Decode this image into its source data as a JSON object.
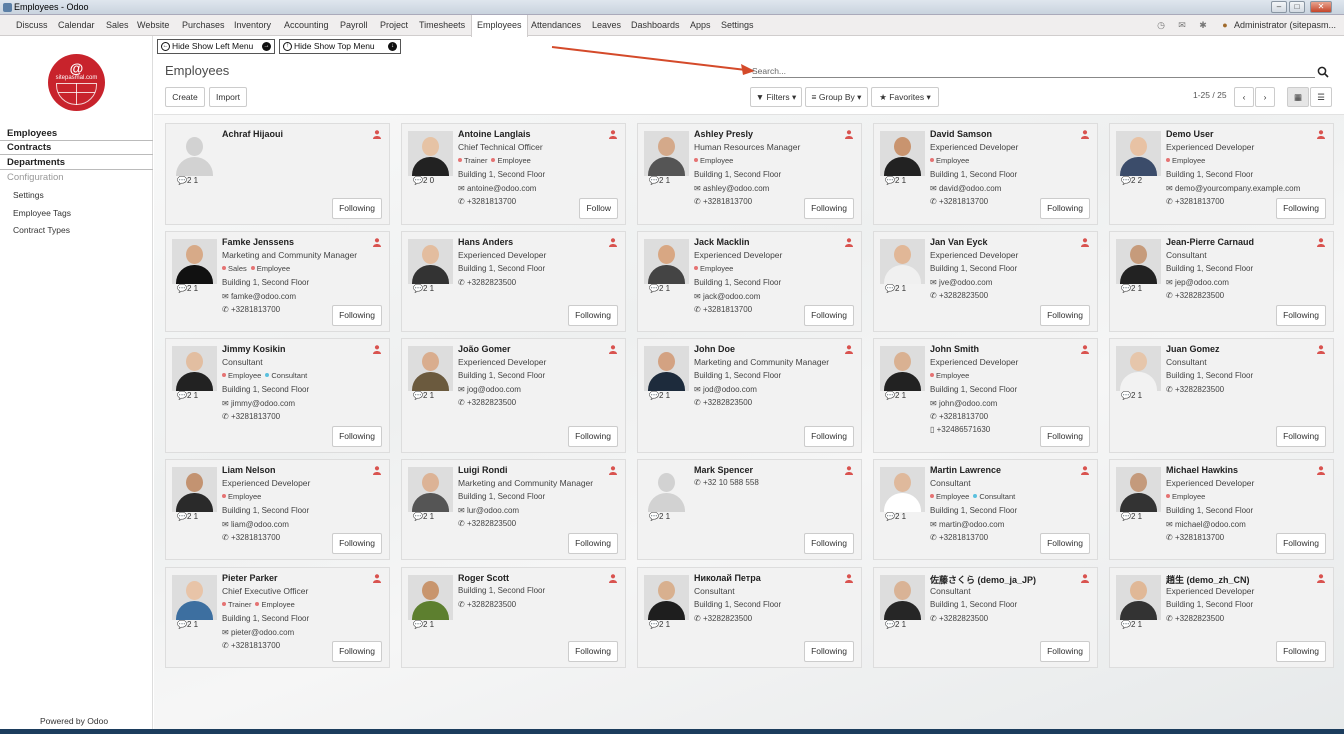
{
  "window": {
    "title": "Employees - Odoo"
  },
  "topmenu": {
    "items": [
      "Discuss",
      "Calendar",
      "Sales",
      "Website",
      "Purchases",
      "Inventory",
      "Accounting",
      "Payroll",
      "Project",
      "Timesheets",
      "Employees",
      "Attendances",
      "Leaves",
      "Dashboards",
      "Apps",
      "Settings"
    ],
    "active": "Employees",
    "user": "Administrator (sitepasm..."
  },
  "sidebar": {
    "logo_symbol": "@",
    "logo_domain": "sitepasmal.com",
    "sections": [
      "Employees",
      "Contracts",
      "Departments"
    ],
    "config_header": "Configuration",
    "config_items": [
      "Settings",
      "Employee Tags",
      "Contract Types"
    ],
    "powered": "Powered by Odoo"
  },
  "toggles": {
    "left_menu": "Hide Show Left Menu",
    "top_menu": "Hide Show Top Menu"
  },
  "control": {
    "title": "Employees",
    "create": "Create",
    "import": "Import",
    "search_placeholder": "Search...",
    "filters": "Filters",
    "group_by": "Group By",
    "favorites": "Favorites",
    "pager": "1-25 / 25"
  },
  "colors": {
    "accent": "#d9534f",
    "tag_trainer": "#e57373",
    "tag_employee": "#e57373",
    "tag_sales": "#e57373",
    "tag_consultant": "#5bc0de"
  },
  "employees": [
    {
      "name": "Achraf Hijaoui",
      "job": "",
      "tags": [],
      "address": "",
      "email": "",
      "phone": "",
      "mobile": "",
      "stats": "2 1",
      "button": "Following"
    },
    {
      "name": "Antoine Langlais",
      "job": "Chief Technical Officer",
      "tags": [
        "Trainer",
        "Employee"
      ],
      "address": "Building 1, Second Floor",
      "email": "antoine@odoo.com",
      "phone": "+3281813700",
      "mobile": "",
      "stats": "2 0",
      "button": "Follow"
    },
    {
      "name": "Ashley Presly",
      "job": "Human Resources Manager",
      "tags": [
        "Employee"
      ],
      "address": "Building 1, Second Floor",
      "email": "ashley@odoo.com",
      "phone": "+3281813700",
      "mobile": "",
      "stats": "2 1",
      "button": "Following"
    },
    {
      "name": "David Samson",
      "job": "Experienced Developer",
      "tags": [
        "Employee"
      ],
      "address": "Building 1, Second Floor",
      "email": "david@odoo.com",
      "phone": "+3281813700",
      "mobile": "",
      "stats": "2 1",
      "button": "Following"
    },
    {
      "name": "Demo User",
      "job": "Experienced Developer",
      "tags": [
        "Employee"
      ],
      "address": "Building 1, Second Floor",
      "email": "demo@yourcompany.example.com",
      "phone": "+3281813700",
      "mobile": "",
      "stats": "2 2",
      "button": "Following"
    },
    {
      "name": "Famke Jenssens",
      "job": "Marketing and Community Manager",
      "tags": [
        "Sales",
        "Employee"
      ],
      "address": "Building 1, Second Floor",
      "email": "famke@odoo.com",
      "phone": "+3281813700",
      "mobile": "",
      "stats": "2 1",
      "button": "Following"
    },
    {
      "name": "Hans Anders",
      "job": "Experienced Developer",
      "tags": [],
      "address": "Building 1, Second Floor",
      "email": "",
      "phone": "+3282823500",
      "mobile": "",
      "stats": "2 1",
      "button": "Following"
    },
    {
      "name": "Jack Macklin",
      "job": "Experienced Developer",
      "tags": [
        "Employee"
      ],
      "address": "Building 1, Second Floor",
      "email": "jack@odoo.com",
      "phone": "+3281813700",
      "mobile": "",
      "stats": "2 1",
      "button": "Following"
    },
    {
      "name": "Jan Van Eyck",
      "job": "Experienced Developer",
      "tags": [],
      "address": "Building 1, Second Floor",
      "email": "jve@odoo.com",
      "phone": "+3282823500",
      "mobile": "",
      "stats": "2 1",
      "button": "Following"
    },
    {
      "name": "Jean-Pierre Carnaud",
      "job": "Consultant",
      "tags": [],
      "address": "Building 1, Second Floor",
      "email": "jep@odoo.com",
      "phone": "+3282823500",
      "mobile": "",
      "stats": "2 1",
      "button": "Following"
    },
    {
      "name": "Jimmy Kosikin",
      "job": "Consultant",
      "tags": [
        "Employee",
        "Consultant"
      ],
      "address": "Building 1, Second Floor",
      "email": "jimmy@odoo.com",
      "phone": "+3281813700",
      "mobile": "",
      "stats": "2 1",
      "button": "Following"
    },
    {
      "name": "João Gomer",
      "job": "Experienced Developer",
      "tags": [],
      "address": "Building 1, Second Floor",
      "email": "jog@odoo.com",
      "phone": "+3282823500",
      "mobile": "",
      "stats": "2 1",
      "button": "Following"
    },
    {
      "name": "John Doe",
      "job": "Marketing and Community Manager",
      "tags": [],
      "address": "Building 1, Second Floor",
      "email": "jod@odoo.com",
      "phone": "+3282823500",
      "mobile": "",
      "stats": "2 1",
      "button": "Following"
    },
    {
      "name": "John Smith",
      "job": "Experienced Developer",
      "tags": [
        "Employee"
      ],
      "address": "Building 1, Second Floor",
      "email": "john@odoo.com",
      "phone": "+3281813700",
      "mobile": "+32486571630",
      "stats": "2 1",
      "button": "Following"
    },
    {
      "name": "Juan Gomez",
      "job": "Consultant",
      "tags": [],
      "address": "Building 1, Second Floor",
      "email": "",
      "phone": "+3282823500",
      "mobile": "",
      "stats": "2 1",
      "button": "Following"
    },
    {
      "name": "Liam Nelson",
      "job": "Experienced Developer",
      "tags": [
        "Employee"
      ],
      "address": "Building 1, Second Floor",
      "email": "liam@odoo.com",
      "phone": "+3281813700",
      "mobile": "",
      "stats": "2 1",
      "button": "Following"
    },
    {
      "name": "Luigi Rondi",
      "job": "Marketing and Community Manager",
      "tags": [],
      "address": "Building 1, Second Floor",
      "email": "lur@odoo.com",
      "phone": "+3282823500",
      "mobile": "",
      "stats": "2 1",
      "button": "Following"
    },
    {
      "name": "Mark Spencer",
      "job": "",
      "tags": [],
      "address": "",
      "email": "",
      "phone": "+32 10 588 558",
      "mobile": "",
      "stats": "2 1",
      "button": "Following"
    },
    {
      "name": "Martin Lawrence",
      "job": "Consultant",
      "tags": [
        "Employee",
        "Consultant"
      ],
      "address": "Building 1, Second Floor",
      "email": "martin@odoo.com",
      "phone": "+3281813700",
      "mobile": "",
      "stats": "2 1",
      "button": "Following"
    },
    {
      "name": "Michael Hawkins",
      "job": "Experienced Developer",
      "tags": [
        "Employee"
      ],
      "address": "Building 1, Second Floor",
      "email": "michael@odoo.com",
      "phone": "+3281813700",
      "mobile": "",
      "stats": "2 1",
      "button": "Following"
    },
    {
      "name": "Pieter Parker",
      "job": "Chief Executive Officer",
      "tags": [
        "Trainer",
        "Employee"
      ],
      "address": "Building 1, Second Floor",
      "email": "pieter@odoo.com",
      "phone": "+3281813700",
      "mobile": "",
      "stats": "2 1",
      "button": "Following"
    },
    {
      "name": "Roger Scott",
      "job": "",
      "tags": [],
      "address": "Building 1, Second Floor",
      "email": "",
      "phone": "+3282823500",
      "mobile": "",
      "stats": "2 1",
      "button": "Following"
    },
    {
      "name": "Николай Петра",
      "job": "Consultant",
      "tags": [],
      "address": "Building 1, Second Floor",
      "email": "",
      "phone": "+3282823500",
      "mobile": "",
      "stats": "2 1",
      "button": "Following"
    },
    {
      "name": "佐藤さくら (demo_ja_JP)",
      "job": "Consultant",
      "tags": [],
      "address": "Building 1, Second Floor",
      "email": "",
      "phone": "+3282823500",
      "mobile": "",
      "stats": "2 1",
      "button": "Following"
    },
    {
      "name": "趙生 (demo_zh_CN)",
      "job": "Experienced Developer",
      "tags": [],
      "address": "Building 1, Second Floor",
      "email": "",
      "phone": "+3282823500",
      "mobile": "",
      "stats": "2 1",
      "button": "Following"
    }
  ]
}
